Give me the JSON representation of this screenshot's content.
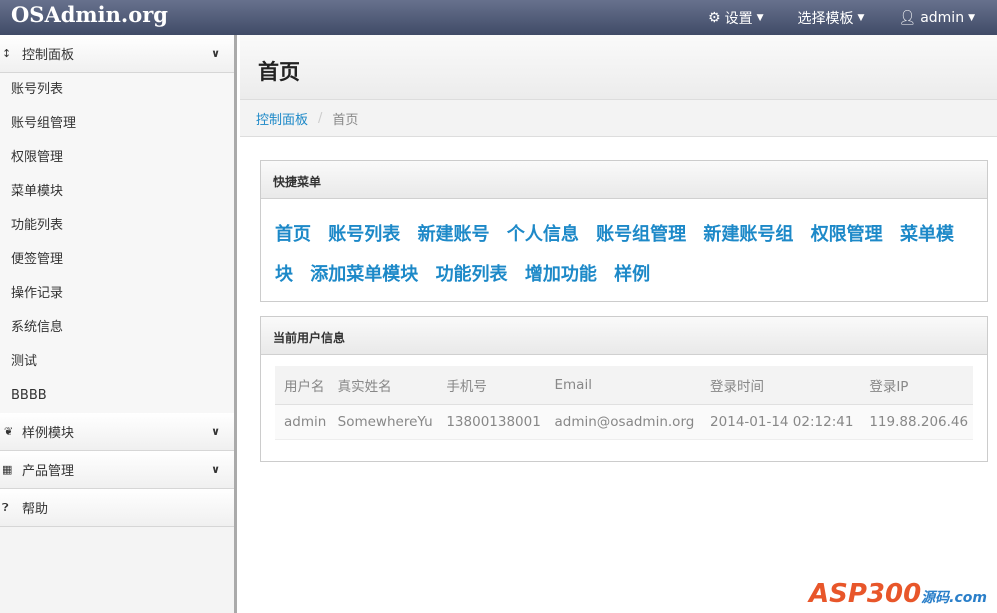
{
  "navbar": {
    "brand": "OSAdmin.org",
    "settings": "设置",
    "template": "选择模板",
    "user": "admin"
  },
  "sidebar": {
    "control": {
      "label": "控制面板",
      "items": [
        "账号列表",
        "账号组管理",
        "权限管理",
        "菜单模块",
        "功能列表",
        "便签管理",
        "操作记录",
        "系统信息",
        "测试",
        "BBBB"
      ]
    },
    "sample": "样例模块",
    "product": "产品管理",
    "help": "帮助"
  },
  "page": {
    "title": "首页",
    "breadcrumb": [
      "控制面板",
      "首页"
    ]
  },
  "quick": {
    "title": "快捷菜单",
    "links": [
      "首页",
      "账号列表",
      "新建账号",
      "个人信息",
      "账号组管理",
      "新建账号组",
      "权限管理",
      "菜单模块",
      "添加菜单模块",
      "功能列表",
      "增加功能",
      "样例"
    ]
  },
  "userinfo": {
    "title": "当前用户信息",
    "headers": [
      "用户名",
      "真实姓名",
      "手机号",
      "Email",
      "登录时间",
      "登录IP"
    ],
    "row": [
      "admin",
      "SomewhereYu",
      "13800138001",
      "admin@osadmin.org",
      "2014-01-14 02:12:41",
      "119.88.206.46"
    ]
  },
  "watermark": {
    "text": "ASP300",
    "sub": "源码.com"
  }
}
